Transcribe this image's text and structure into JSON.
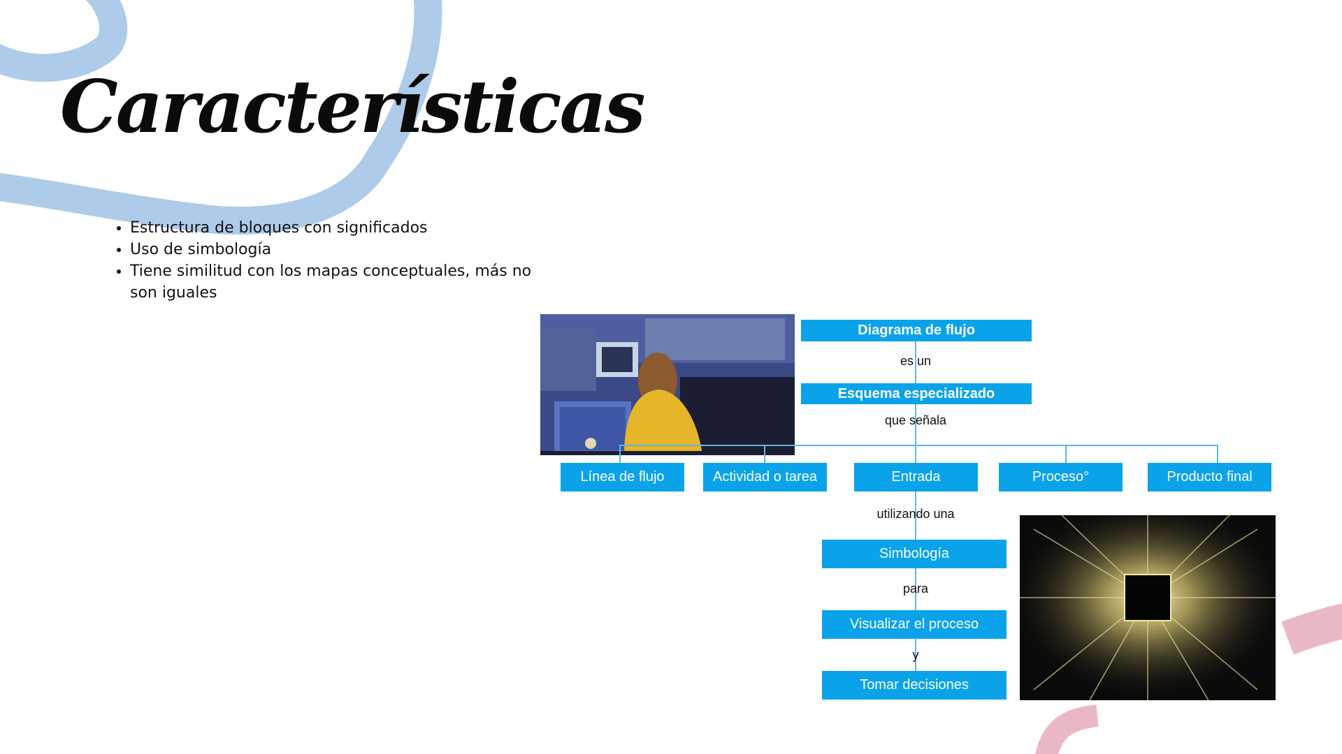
{
  "slide": {
    "title": "Características",
    "bullets": [
      "Estructura de bloques con significados",
      "Uso de simbología",
      "Tiene similitud con los mapas conceptuales, más no son iguales"
    ]
  },
  "diagram": {
    "root": "Diagrama de flujo",
    "link1": "es un",
    "level2": "Esquema especializado",
    "link2": "que señala",
    "branches": [
      "Línea de flujo",
      "Actividad o tarea",
      "Entrada",
      "Proceso°",
      "Producto final"
    ],
    "link3": "utilizando una",
    "level4": "Simbología",
    "link4": "para",
    "level5": "Visualizar el proceso",
    "link5": "y",
    "level6": "Tomar decisiones"
  },
  "colors": {
    "box": "#0aa3ea",
    "connector": "#5fb6e0",
    "deco_blue": "#aecbea",
    "deco_pink": "#eab8c4"
  },
  "images": {
    "office_photo": "person-at-computer-photo",
    "chip_photo": "glowing-microchip-photo"
  }
}
